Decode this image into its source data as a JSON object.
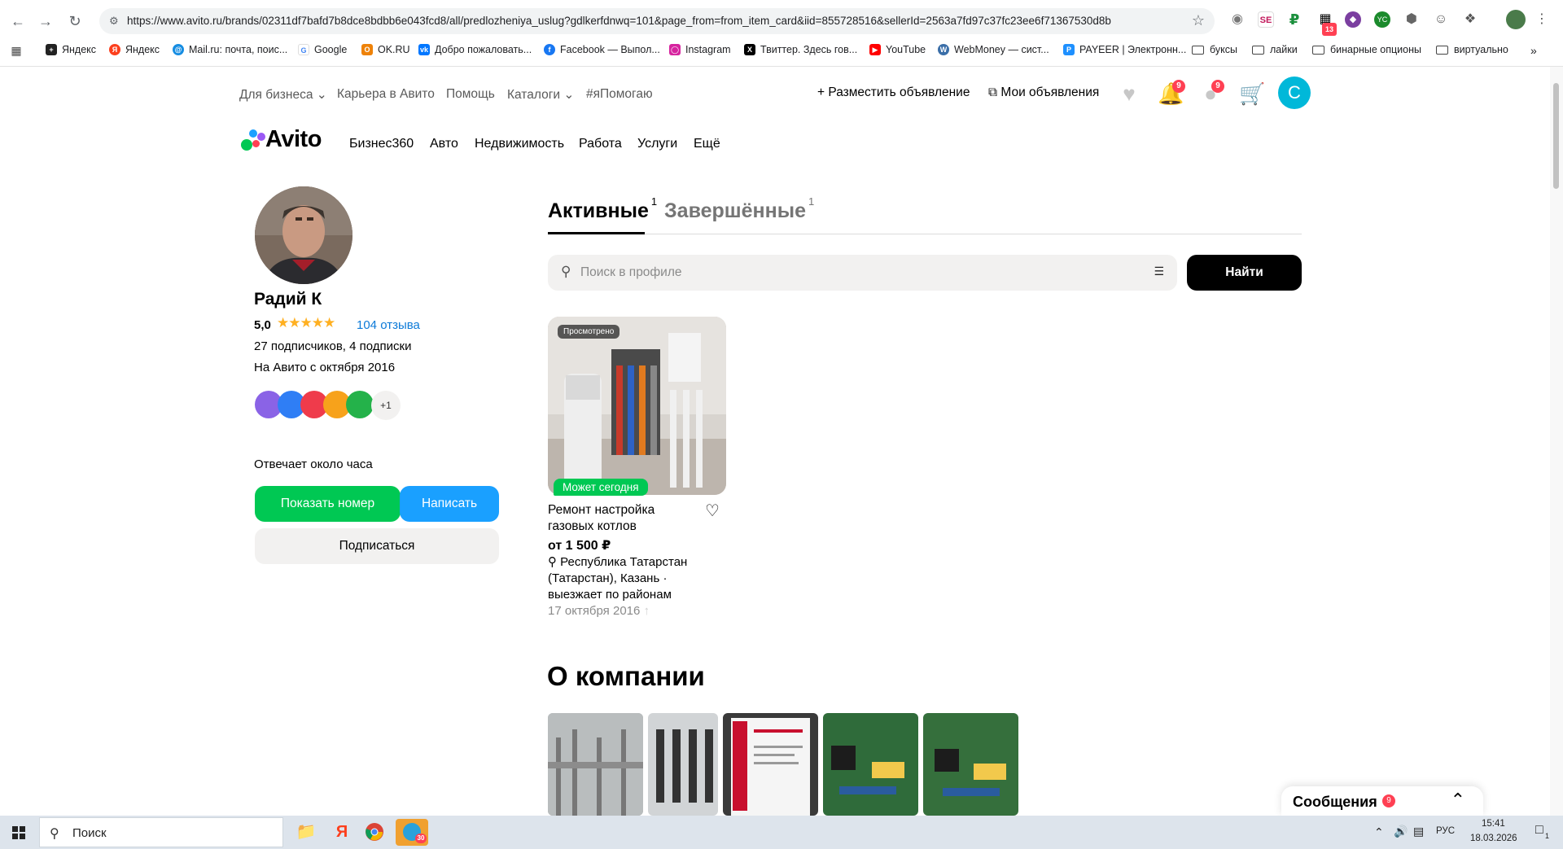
{
  "browser": {
    "url": "https://www.avito.ru/brands/02311df7bafd7b8dce8bdbb6e043fcd8/all/predlozheniya_uslug?gdlkerfdnwq=101&page_from=from_item_card&iid=855728516&sellerId=2563a7fd97c37fc23ee6f71367530d8b",
    "ext_badge": "13",
    "bookmarks": [
      {
        "label": "Яндекс",
        "color": "#222222"
      },
      {
        "label": "Яндекс",
        "color": "#fc3f1d"
      },
      {
        "label": "Mail.ru: почта, поис...",
        "color": "#168de2"
      },
      {
        "label": "Google",
        "color": "#4285f4"
      },
      {
        "label": "OK.RU",
        "color": "#ee8208"
      },
      {
        "label": "Добро пожаловать...",
        "color": "#0077ff"
      },
      {
        "label": "Facebook — Выпол...",
        "color": "#1877f2"
      },
      {
        "label": "Instagram",
        "color": "#d6249f"
      },
      {
        "label": "Твиттер. Здесь гов...",
        "color": "#000000"
      },
      {
        "label": "YouTube",
        "color": "#ff0000"
      },
      {
        "label": "WebMoney — сист...",
        "color": "#3a6ea8"
      },
      {
        "label": "PAYEER | Электронн...",
        "color": "#1e90ff"
      },
      {
        "label": "буксы",
        "folder": true
      },
      {
        "label": "лайки",
        "folder": true
      },
      {
        "label": "бинарные опционы",
        "folder": true
      },
      {
        "label": "виртуально",
        "folder": true
      }
    ]
  },
  "header": {
    "top_links": [
      "Для бизнеса",
      "Карьера в Авито",
      "Помощь",
      "Каталоги",
      "#яПомогаю"
    ],
    "post_ad": "Разместить объявление",
    "my_ads": "Мои объявления",
    "notif_badge": "9",
    "msg_badge": "9",
    "avatar_letter": "С",
    "logo": "Avito",
    "categories": [
      "Бизнес360",
      "Авто",
      "Недвижимость",
      "Работа",
      "Услуги",
      "Ещё"
    ]
  },
  "profile": {
    "name": "Радий К",
    "rating": "5,0",
    "stars": "★★★★★",
    "reviews": "104 отзыва",
    "followers": "27 подписчиков, 4 подписки",
    "since": "На Авито с октября 2016",
    "more_achievements": "+1",
    "reply_time": "Отвечает около часа",
    "show_phone": "Показать номер",
    "write": "Написать",
    "subscribe": "Подписаться"
  },
  "tabs": {
    "active": "Активные",
    "active_count": "1",
    "finished": "Завершённые",
    "finished_count": "1"
  },
  "search": {
    "placeholder": "Поиск в профиле",
    "button": "Найти"
  },
  "item": {
    "viewed": "Просмотрено",
    "today": "Может сегодня",
    "title": "Ремонт настройка газовых котлов",
    "price": "от 1 500 ₽",
    "location": "Республика Татарстан (Татарстан), Казань · выезжает по районам",
    "date": "17 октября 2016"
  },
  "about": {
    "title": "О компании"
  },
  "messages": {
    "label": "Сообщения",
    "badge": "9"
  },
  "taskbar": {
    "search": "Поиск",
    "tg_badge": "30",
    "lang": "РУС",
    "time": "15:41",
    "date": "18.03.2026",
    "notif": "1"
  }
}
